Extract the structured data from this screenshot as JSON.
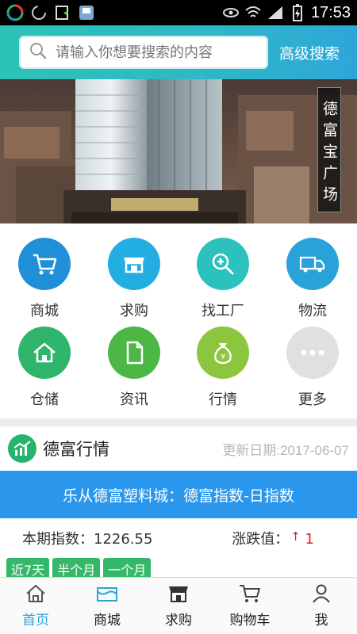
{
  "status_bar": {
    "time": "17:53"
  },
  "header": {
    "search_placeholder": "请输入你想要搜索的内容",
    "advanced_search": "高级搜索"
  },
  "banner": {
    "caption": "德富宝广场"
  },
  "grid": {
    "items": [
      {
        "label": "商城",
        "icon": "cart-icon",
        "color": "#1f8fd8"
      },
      {
        "label": "求购",
        "icon": "shop-icon",
        "color": "#22aee3"
      },
      {
        "label": "找工厂",
        "icon": "zoom-in-icon",
        "color": "#2bc1bd"
      },
      {
        "label": "物流",
        "icon": "truck-icon",
        "color": "#2aa1d8"
      },
      {
        "label": "仓储",
        "icon": "home-icon",
        "color": "#2fb46c"
      },
      {
        "label": "资讯",
        "icon": "document-icon",
        "color": "#4cb745"
      },
      {
        "label": "行情",
        "icon": "money-bag-icon",
        "color": "#8cc63f"
      },
      {
        "label": "更多",
        "icon": "more-icon",
        "color": "#e0e0e0"
      }
    ]
  },
  "market": {
    "title": "德富行情",
    "date": "更新日期:2017-06-07",
    "bar": "乐从德富塑料城：德富指数-日指数",
    "index_label": "本期指数：1226.55",
    "change_label": "涨跌值：",
    "change_value": "1",
    "tabs": [
      "近7天",
      "半个月",
      "一个月"
    ]
  },
  "bottom_nav": [
    {
      "label": "首页",
      "icon": "home-icon",
      "active": true
    },
    {
      "label": "商城",
      "icon": "mall-icon",
      "active": false
    },
    {
      "label": "求购",
      "icon": "shop-icon",
      "active": false
    },
    {
      "label": "购物车",
      "icon": "cart-icon",
      "active": false
    },
    {
      "label": "我",
      "icon": "user-icon",
      "active": false
    }
  ],
  "colors": {
    "accent": "#2ab3c8",
    "blue_bar": "#2b97ec",
    "active_tab": "#2aa3d6",
    "up": "#e0222a"
  }
}
